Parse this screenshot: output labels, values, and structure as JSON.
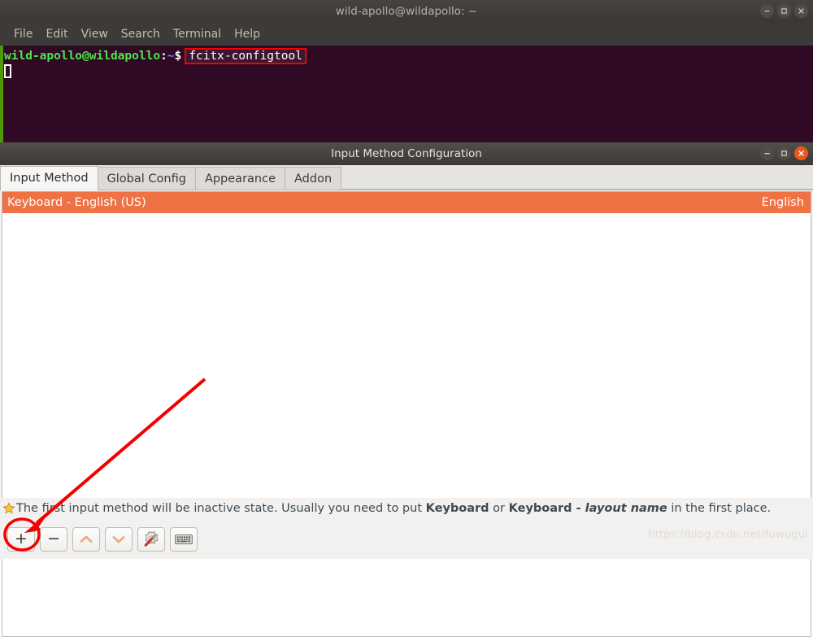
{
  "terminal": {
    "title": "wild-apollo@wildapollo: ~",
    "menu": [
      "File",
      "Edit",
      "View",
      "Search",
      "Terminal",
      "Help"
    ],
    "prompt_user": "wild-apollo@wildapollo",
    "prompt_colon": ":",
    "prompt_path": "~",
    "prompt_dollar": "$",
    "command": "fcitx-configtool",
    "window_controls": {
      "minimize": "minimize-icon",
      "maximize": "maximize-icon",
      "close": "close-icon"
    }
  },
  "config": {
    "title": "Input Method Configuration",
    "window_controls": {
      "minimize": "minimize-icon",
      "maximize": "maximize-icon",
      "close": "close-icon"
    },
    "tabs": [
      {
        "label": "Input Method",
        "selected": true
      },
      {
        "label": "Global Config",
        "selected": false
      },
      {
        "label": "Appearance",
        "selected": false
      },
      {
        "label": "Addon",
        "selected": false
      }
    ],
    "input_methods": [
      {
        "name": "Keyboard - English (US)",
        "language": "English",
        "selected": true
      }
    ],
    "status": {
      "icon": "star-icon",
      "text_part1": "The first input method will be inactive state. Usually you need to put ",
      "bold1": "Keyboard",
      "text_part2": " or ",
      "bold2": "Keyboard - ",
      "italic": "layout name",
      "text_part3": " in the first place."
    },
    "toolbar": [
      {
        "name": "add-input-method-button",
        "glyph": "+",
        "label": "Add"
      },
      {
        "name": "remove-input-method-button",
        "glyph": "−",
        "label": "Remove"
      },
      {
        "name": "move-up-button",
        "glyph": "chevron-up-icon",
        "label": "Move Up"
      },
      {
        "name": "move-down-button",
        "glyph": "chevron-down-icon",
        "label": "Move Down"
      },
      {
        "name": "configure-button",
        "glyph": "gear-screwdriver-icon",
        "label": "Configure"
      },
      {
        "name": "keyboard-layout-button",
        "glyph": "keyboard-icon",
        "label": "Keyboard Layout"
      }
    ]
  },
  "watermark": "https://blog.csdn.net/fuwugui",
  "colors": {
    "terminal_bg": "#300a24",
    "terminal_green_border": "#4e9a06",
    "prompt_green": "#4ee44e",
    "prompt_blue": "#5c8ff7",
    "selection_orange": "#ef7245",
    "close_button_orange": "#e8581c",
    "annotation_red": "#f40000"
  }
}
